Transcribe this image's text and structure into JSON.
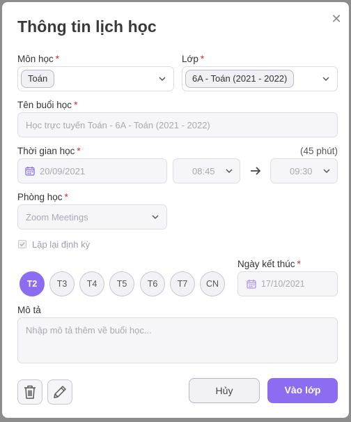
{
  "dialog": {
    "title": "Thông tin lịch học",
    "close_icon": "close-icon"
  },
  "subject": {
    "label": "Môn học",
    "required": "*",
    "value": "Toán"
  },
  "class": {
    "label": "Lớp",
    "required": "*",
    "value": "6A - Toán (2021 - 2022)"
  },
  "session_name": {
    "label": "Tên buổi học",
    "required": "*",
    "value": "Học trực tuyến Toán - 6A - Toán (2021 - 2022)"
  },
  "time": {
    "label": "Thời gian học",
    "required": "*",
    "duration": "(45 phút)",
    "date": "20/09/2021",
    "start": "08:45",
    "arrow": "→",
    "end": "09:30"
  },
  "room": {
    "label": "Phòng học",
    "required": "*",
    "value": "Zoom Meetings"
  },
  "repeat": {
    "label": "Lặp lại định kỳ",
    "checked": true
  },
  "weekdays": [
    "T2",
    "T3",
    "T4",
    "T5",
    "T6",
    "T7",
    "CN"
  ],
  "active_weekday": "T2",
  "end_date": {
    "label": "Ngày kết thúc",
    "required": "*",
    "value": "17/10/2021"
  },
  "description": {
    "label": "Mô tả",
    "placeholder": "Nhập mô tả thêm về buổi học..."
  },
  "buttons": {
    "cancel": "Hủy",
    "join": "Vào lớp"
  },
  "colors": {
    "accent": "#8c6cf0",
    "required": "#e02424"
  }
}
